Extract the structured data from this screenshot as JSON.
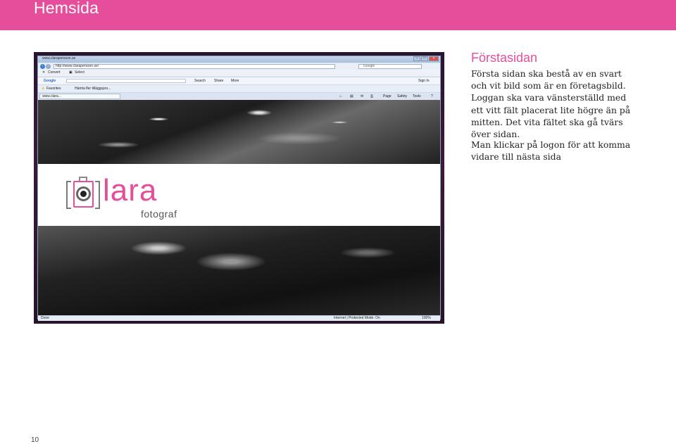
{
  "header": {
    "title": "Hemsida"
  },
  "screenshot": {
    "window_title": "www.clarapersson.se",
    "address_url": "http://www.clarapersson.se/",
    "google_box": "Google",
    "menu": {
      "convert": "Convert",
      "select": "Select"
    },
    "google_toolbar": {
      "logo": "Google",
      "search": "Search",
      "share": "Share",
      "more": "More",
      "sign_in": "Sign In"
    },
    "favorites": {
      "favorites": "Favorites",
      "suggested": "Hämta fler tilläggspro..."
    },
    "tab_label": "www.clara...",
    "tools": {
      "page": "Page",
      "safety": "Safety",
      "tools": "Tools"
    },
    "logo": {
      "main": "lara",
      "sub": "fotograf"
    },
    "status": {
      "done": "Done",
      "zone": "Internet | Protected Mode: On",
      "zoom": "100%"
    }
  },
  "aside": {
    "heading": "Förstasidan",
    "paragraph1": "Första sidan ska bestå av en svart och vit bild som är en företagsbild. Loggan ska vara vänsterställd med ett vitt fält placerat lite högre än på mitten. Det vita fältet ska gå tvärs över sidan.",
    "paragraph2": "Man klickar på logon för att komma vidare till nästa sida"
  },
  "page_number": "10",
  "colors": {
    "brand_pink": "#e64d9a"
  }
}
